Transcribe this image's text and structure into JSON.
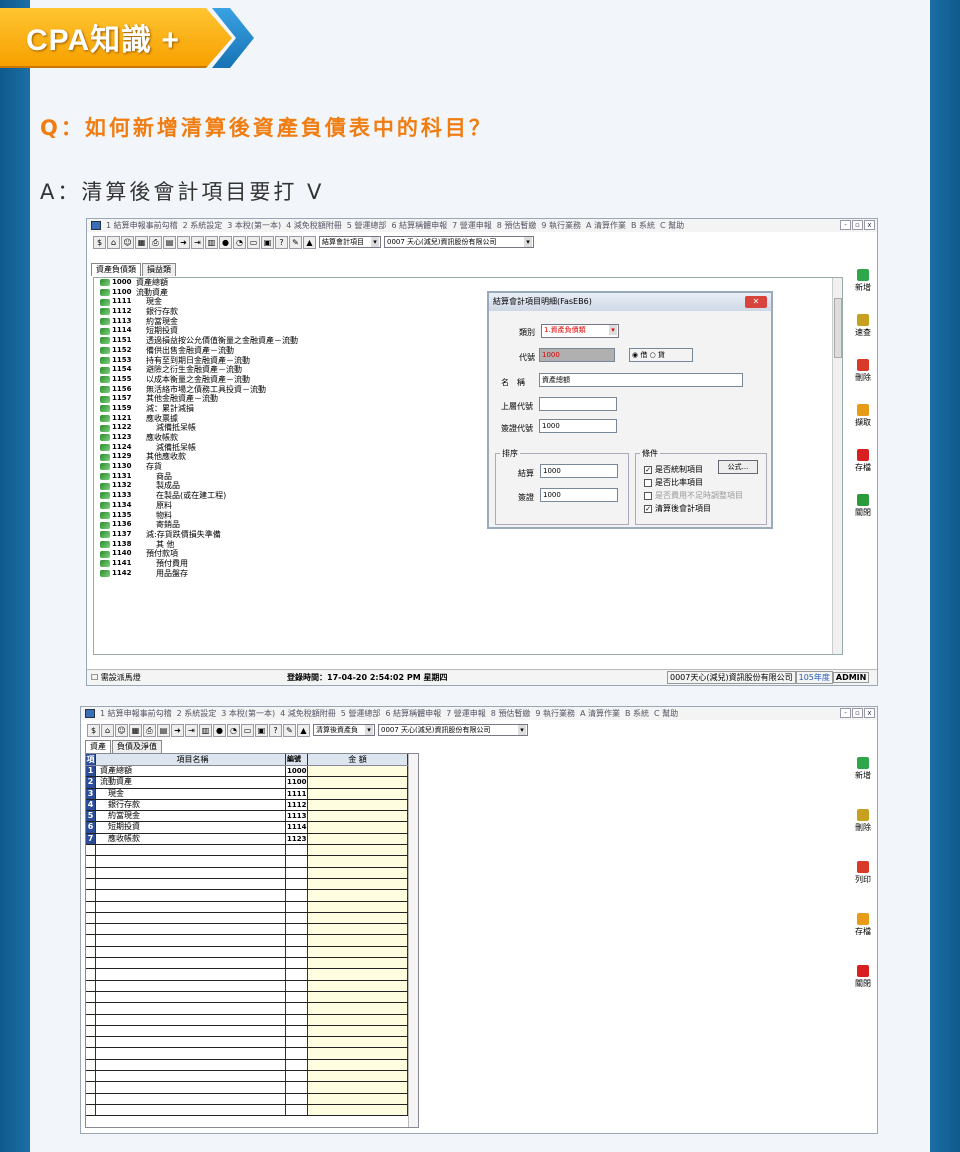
{
  "badge": {
    "text": "CPA知識 +"
  },
  "question": "Q：如何新增清算後資產負債表中的科目？",
  "answer": "A：清算後會計項目要打 V",
  "menu": [
    "1 結算申報事前勾稽",
    "2 系統設定",
    "3 本稅(第一本)",
    "4 減免稅額附冊",
    "5 營運總部",
    "6 結算稱體申報",
    "7 營運申報",
    "8 預估暫繳",
    "9 執行業務",
    "A 清算作業",
    "B 系統",
    "C 幫助"
  ],
  "window_controls": [
    "-",
    "▫",
    "x"
  ],
  "toolbar_icons": [
    "dollar-icon",
    "home-icon",
    "people-icon",
    "calc-icon",
    "print-icon",
    "doc-icon",
    "arrow-icon",
    "tab-icon",
    "book-icon",
    "globe-icon",
    "pie-icon",
    "folder-icon",
    "screen-icon",
    "help-icon",
    "tool-icon",
    "chart-icon"
  ],
  "screen1": {
    "select_item": "結算會計項目",
    "company": "0007 天心(減兒)資訊股份有限公司",
    "tabs": [
      "資產負債類",
      "損益類"
    ],
    "tree": [
      {
        "code": "1000",
        "name": "資產總額",
        "indent": 0
      },
      {
        "code": "1100",
        "name": "流動資產",
        "indent": 0
      },
      {
        "code": "1111",
        "name": "現金",
        "indent": 1
      },
      {
        "code": "1112",
        "name": "銀行存款",
        "indent": 1
      },
      {
        "code": "1113",
        "name": "約當現金",
        "indent": 1
      },
      {
        "code": "1114",
        "name": "短期投資",
        "indent": 1
      },
      {
        "code": "1151",
        "name": "透過損益按公允價值衡量之金融資產－流動",
        "indent": 1
      },
      {
        "code": "1152",
        "name": "備供出售金融資產－流動",
        "indent": 1
      },
      {
        "code": "1153",
        "name": "持有至到期日金融資產－流動",
        "indent": 1
      },
      {
        "code": "1154",
        "name": "避險之衍生金融資產－流動",
        "indent": 1
      },
      {
        "code": "1155",
        "name": "以成本衡量之金融資產－流動",
        "indent": 1
      },
      {
        "code": "1156",
        "name": "無活絡市場之債務工具投資－流動",
        "indent": 1
      },
      {
        "code": "1157",
        "name": "其他金融資產－流動",
        "indent": 1
      },
      {
        "code": "1159",
        "name": "減：累計減損",
        "indent": 1
      },
      {
        "code": "1121",
        "name": "應收票據",
        "indent": 1
      },
      {
        "code": "1122",
        "name": "減備抵呆帳",
        "indent": 2
      },
      {
        "code": "1123",
        "name": "應收帳款",
        "indent": 1
      },
      {
        "code": "1124",
        "name": "減備抵呆帳",
        "indent": 2
      },
      {
        "code": "1129",
        "name": "其他應收款",
        "indent": 1
      },
      {
        "code": "1130",
        "name": "存貨",
        "indent": 1
      },
      {
        "code": "1131",
        "name": "商品",
        "indent": 2
      },
      {
        "code": "1132",
        "name": "製成品",
        "indent": 2
      },
      {
        "code": "1133",
        "name": "在製品(或在建工程)",
        "indent": 2
      },
      {
        "code": "1134",
        "name": "原料",
        "indent": 2
      },
      {
        "code": "1135",
        "name": "物料",
        "indent": 2
      },
      {
        "code": "1136",
        "name": "寄銷品",
        "indent": 2
      },
      {
        "code": "1137",
        "name": "減:存貨跌價損失準備",
        "indent": 1
      },
      {
        "code": "1138",
        "name": "其 他",
        "indent": 2
      },
      {
        "code": "1140",
        "name": "預付款項",
        "indent": 1
      },
      {
        "code": "1141",
        "name": "預付費用",
        "indent": 2
      },
      {
        "code": "1142",
        "name": "用品盤存",
        "indent": 2
      }
    ],
    "side_buttons": [
      "新增",
      "速查",
      "刪除",
      "擷取",
      "存檔",
      "關閉"
    ],
    "dialog": {
      "title": "結算會計項目明細(FasEB6)",
      "category_label": "類別",
      "category_value": "1.資產負債類",
      "code_label": "代號",
      "code_value": "1000",
      "debit": "借",
      "credit": "貸",
      "name_label": "名　稱",
      "name_value": "資產總額",
      "parent_label": "上層代號",
      "parent_value": "",
      "visa_code_label": "簽證代號",
      "visa_code_value": "1000",
      "sort_group": "排序",
      "sort_settle_label": "結算",
      "sort_settle_value": "1000",
      "sort_visa_label": "簽證",
      "sort_visa_value": "1000",
      "cond_group": "條件",
      "checks": [
        {
          "label": "是否統制項目",
          "checked": true
        },
        {
          "label": "是否比率項目",
          "checked": false
        },
        {
          "label": "是否費用不足時調整項目",
          "checked": false
        },
        {
          "label": "清算後會計項目",
          "checked": true
        }
      ],
      "formula_button": "公式..."
    },
    "status": {
      "check": "需設派馬燈",
      "login": "登錄時間：17-04-20 2:54:02 PM 星期四",
      "company": "0007天心(減兒)資訊股份有限公司",
      "year": "105年度",
      "user": "ADMIN"
    }
  },
  "screen2": {
    "select_item": "清算後資產負",
    "company": "0007 天心(減兒)資訊股份有限公司",
    "tabs": [
      "資產",
      "負債及淨值"
    ],
    "headers": {
      "idx": "項",
      "name": "項目名稱",
      "code": "編號",
      "amount": "金 額"
    },
    "rows": [
      {
        "idx": "1",
        "name": "資產總額",
        "code": "1000"
      },
      {
        "idx": "2",
        "name": "流動資產",
        "code": "1100"
      },
      {
        "idx": "3",
        "name": "現金",
        "code": "1111"
      },
      {
        "idx": "4",
        "name": "銀行存款",
        "code": "1112"
      },
      {
        "idx": "5",
        "name": "約當現金",
        "code": "1113"
      },
      {
        "idx": "6",
        "name": "短期投資",
        "code": "1114"
      },
      {
        "idx": "7",
        "name": "應收帳款",
        "code": "1123"
      }
    ],
    "side_buttons": [
      "新增",
      "刪除",
      "列印",
      "存檔",
      "關閉"
    ]
  }
}
